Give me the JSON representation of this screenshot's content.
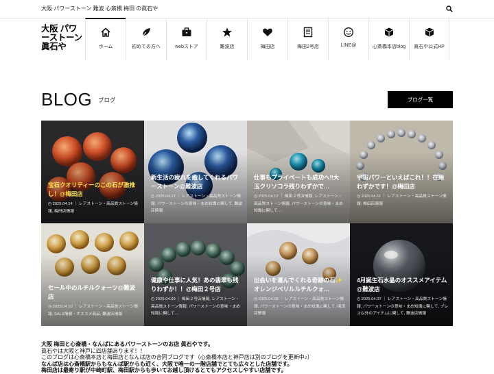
{
  "topbar": {
    "tagline": "大阪 パワーストーン 難波 心斎橋 梅田 の眞石や",
    "search_icon": "search-icon"
  },
  "logo": {
    "line1": "大阪 パワ",
    "line2": "ーストーン",
    "line3": "眞石や"
  },
  "nav": [
    {
      "label": "ホーム",
      "icon": "home-icon",
      "active": true
    },
    {
      "label": "初めての方へ",
      "icon": "leaf-icon",
      "active": false
    },
    {
      "label": "webストア",
      "icon": "briefcase-icon",
      "active": false
    },
    {
      "label": "難波店",
      "icon": "star-icon",
      "active": false
    },
    {
      "label": "梅田店",
      "icon": "heart-icon",
      "active": false
    },
    {
      "label": "梅田2号店",
      "icon": "book-icon",
      "active": false
    },
    {
      "label": "LINE@",
      "icon": "smiley-icon",
      "active": false
    },
    {
      "label": "心斎橋本店blog",
      "icon": "cube-icon",
      "active": false
    },
    {
      "label": "眞石や公式HP",
      "icon": "cube-icon",
      "active": false
    }
  ],
  "blog": {
    "title": "BLOG",
    "subtitle": "ブログ",
    "button": "ブログ一覧"
  },
  "posts": [
    {
      "title": "宝石クオリティーのこの石が激推し！@梅田店",
      "date": "2025.04.14",
      "categories": "レアストーン・高品質ストーン情報, 梅田店情報"
    },
    {
      "title": "新生活の疲れを癒してくれるパワーストーン@難波店",
      "date": "2025.04.13",
      "categories": "レアストーン・高品質ストーン情報, パワーストーンの意味・まめ知識に関して, 難波店情報"
    },
    {
      "title": "仕事もプライベートも成功へ‼︎大玉クリソコラ残りわずかで…",
      "date": "2025.04.12",
      "categories": "梅田２号店情報, レアストーン・高品質ストーン情報, パワーストーンの意味・まめ知識に関して…"
    },
    {
      "title": "宇宙パワーといえばこれ！！在庫わずかです！@梅田店",
      "date": "2025.04.11",
      "categories": "レアストーン・高品質ストーン情報, 梅田店情報"
    },
    {
      "title": "セール中のルチルクォーツ@難波店",
      "date": "2025.04.10",
      "categories": "レアストーン・高品質ストーン情報, SALE情報・オススメ商品, 難波店情報"
    },
    {
      "title": "健康や仕事に人気！あの翡翠も残りわずか！！@梅田２号店",
      "date": "2025.04.09",
      "categories": "梅田２号店情報, レアストーン・高品質ストーン情報, パワーストーンの意味・まめ知識に関して…"
    },
    {
      "title": "出会いを運んでくれる奇跡の石✨オレンジベリルルチルクォ…",
      "date": "2025.04.08",
      "categories": "レアストーン・高品質ストーン情報, パワーストーンの意味・まめ知識に関して, 梅田店情報"
    },
    {
      "title": "4月誕生石水晶のオススメアイテム@難波店",
      "date": "2025.04.07",
      "categories": "レアストーン・高品質ストーン情報, パワーストーンの意味・まめ知識に関して, ブレス以外のアイテムに関して, 難波店情報"
    }
  ],
  "description": {
    "line1": "大阪 梅田と心斎橋・なんばにあるパワーストーンのお店 眞石やです。",
    "line2": "眞石やは大阪と神戸に四店舗あります！！",
    "line3": "このブログは心斎橋本店と梅田店となんば店の合同ブログです（心斎橋本店と神戸店は別のブログを更新中♪）",
    "line4": "なんば店は心斎橋駅からもなんば駅からも近く、大阪で唯一の一階店舗でとても広々とした店舗です。",
    "line5": "梅田店は最寄り駅が中崎町駅、梅田駅からも歩いてお越し頂けるとてもアクセスしやすい店舗です。"
  },
  "colors": {
    "nav_active": "#000000",
    "button_bg": "#000000",
    "card_text": "#ffffff",
    "highlight": "#ffe14d"
  }
}
